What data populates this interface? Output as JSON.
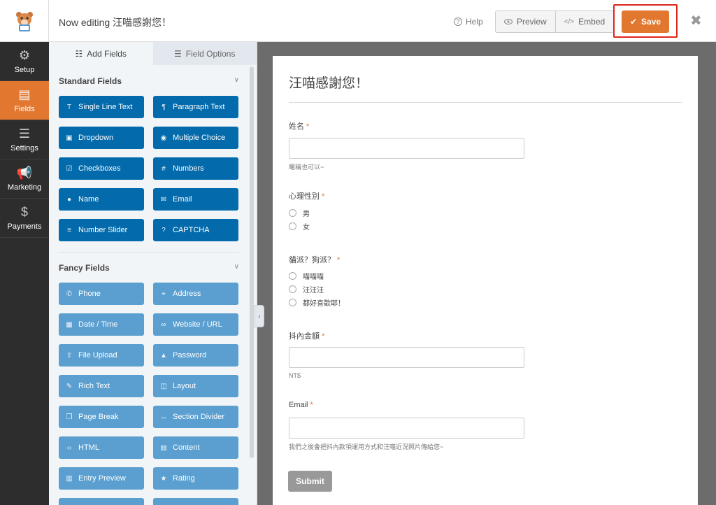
{
  "header": {
    "editing_label": "Now editing 汪喵感謝您！",
    "help_label": "Help",
    "preview_label": "Preview",
    "embed_label": "Embed",
    "save_label": "Save",
    "accent_color": "#e27730",
    "highlight_color": "#e0251b"
  },
  "leftnav": {
    "items": [
      {
        "label": "Setup",
        "icon": "gear-icon"
      },
      {
        "label": "Fields",
        "icon": "fields-icon",
        "active": true
      },
      {
        "label": "Settings",
        "icon": "sliders-icon"
      },
      {
        "label": "Marketing",
        "icon": "megaphone-icon"
      },
      {
        "label": "Payments",
        "icon": "dollar-icon"
      }
    ]
  },
  "panel": {
    "tabs": [
      {
        "label": "Add Fields",
        "icon": "list-icon"
      },
      {
        "label": "Field Options",
        "icon": "sliders-icon"
      }
    ],
    "standard_title": "Standard Fields",
    "standard_fields": [
      {
        "label": "Single Line Text",
        "icon": "text-icon"
      },
      {
        "label": "Paragraph Text",
        "icon": "paragraph-icon"
      },
      {
        "label": "Dropdown",
        "icon": "dropdown-icon"
      },
      {
        "label": "Multiple Choice",
        "icon": "radio-icon"
      },
      {
        "label": "Checkboxes",
        "icon": "checkbox-icon"
      },
      {
        "label": "Numbers",
        "icon": "hash-icon"
      },
      {
        "label": "Name",
        "icon": "user-icon"
      },
      {
        "label": "Email",
        "icon": "envelope-icon"
      },
      {
        "label": "Number Slider",
        "icon": "slider-icon"
      },
      {
        "label": "CAPTCHA",
        "icon": "question-icon"
      }
    ],
    "fancy_title": "Fancy Fields",
    "fancy_fields": [
      {
        "label": "Phone",
        "icon": "phone-icon"
      },
      {
        "label": "Address",
        "icon": "map-pin-icon"
      },
      {
        "label": "Date / Time",
        "icon": "calendar-icon"
      },
      {
        "label": "Website / URL",
        "icon": "link-icon"
      },
      {
        "label": "File Upload",
        "icon": "upload-icon"
      },
      {
        "label": "Password",
        "icon": "lock-icon"
      },
      {
        "label": "Rich Text",
        "icon": "edit-icon"
      },
      {
        "label": "Layout",
        "icon": "layout-icon"
      },
      {
        "label": "Page Break",
        "icon": "copy-icon"
      },
      {
        "label": "Section Divider",
        "icon": "arrows-icon"
      },
      {
        "label": "HTML",
        "icon": "code-icon"
      },
      {
        "label": "Content",
        "icon": "file-icon"
      },
      {
        "label": "Entry Preview",
        "icon": "document-icon"
      },
      {
        "label": "Rating",
        "icon": "star-icon"
      }
    ]
  },
  "form": {
    "title": "汪喵感謝您！",
    "fields": [
      {
        "label": "姓名",
        "required": "*",
        "description": "暱稱也可以~"
      },
      {
        "label": "心理性別",
        "required": "*",
        "choices": [
          "男",
          "女"
        ]
      },
      {
        "label": "貓派？狗派？",
        "required": "*",
        "choices": [
          "喵喵喵",
          "汪汪汪",
          "都好喜歡耶！"
        ]
      },
      {
        "label": "抖內金額",
        "required": "*",
        "description": "NT$"
      },
      {
        "label": "Email",
        "required": "*",
        "description": "我們之後會把抖內款項運用方式和汪喵近況照片傳給您~"
      }
    ],
    "submit_label": "Submit"
  }
}
